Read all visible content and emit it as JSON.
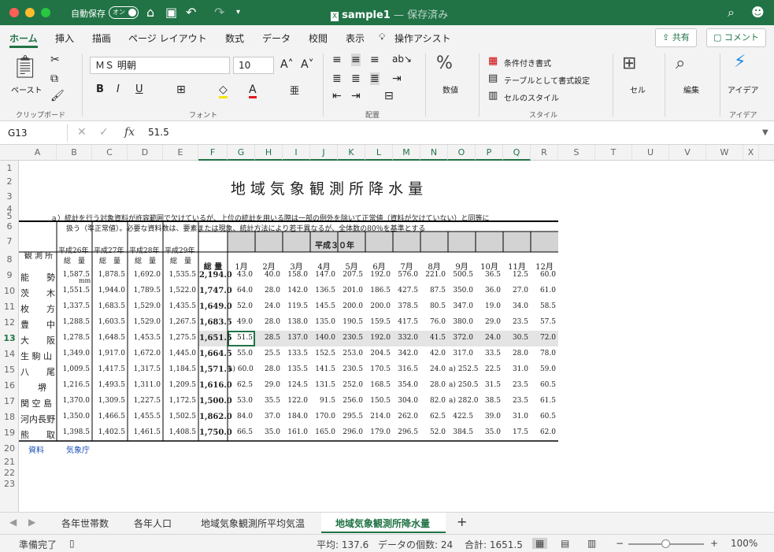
{
  "title_bar": {
    "autosave": "自動保存",
    "toggle": "オン",
    "filename": "sample1",
    "saved": " — 保存済み"
  },
  "ribbon_tabs": [
    "ホーム",
    "挿入",
    "描画",
    "ページ レイアウト",
    "数式",
    "データ",
    "校閲",
    "表示",
    "操作アシスト"
  ],
  "share": "共有",
  "comment": "コメント",
  "ribbon": {
    "paste": "ペースト",
    "clipboard": "クリップボード",
    "font_name": "ＭＳ 明朝",
    "font_size": "10",
    "font": "フォント",
    "align": "配置",
    "number": "数値",
    "cond": "条件付き書式",
    "table": "テーブルとして書式設定",
    "cellstyle": "セルのスタイル",
    "style": "スタイル",
    "cell": "セル",
    "edit": "編集",
    "ideas": "アイデア",
    "ideas_grp": "アイデア"
  },
  "formula_bar": {
    "namebox": "G13",
    "value": "51.5"
  },
  "columns": [
    "A",
    "B",
    "C",
    "D",
    "E",
    "F",
    "G",
    "H",
    "I",
    "J",
    "K",
    "L",
    "M",
    "N",
    "O",
    "P",
    "Q",
    "R",
    "S",
    "T",
    "U",
    "V",
    "W",
    "X"
  ],
  "rows": [
    "1",
    "2",
    "3",
    "4",
    "5",
    "6",
    "7",
    "8",
    "9",
    "10",
    "11",
    "12",
    "13",
    "14",
    "15",
    "16",
    "17",
    "18",
    "19",
    "20",
    "21",
    "22",
    "23"
  ],
  "sheet": {
    "title": "地 域 気 象 観 測 所 降 水 量",
    "note1": "ａ）統計を行う対象資料が許容範囲で欠けているが、上位の統計を用いる際は一部の例外を除いて正常値（資料が欠けていない）と同等に",
    "note2": "扱う（準正常値）。必要な資料数は、要素または現象、統計方法により若干異なるが、全体数の80％を基準とする",
    "header_station": "観 測 所",
    "years": [
      "平成26年",
      "平成27年",
      "平成28年",
      "平成29年"
    ],
    "year_sub": "総　量",
    "heisei30": "平成３０年",
    "total": "総 量",
    "months": [
      "1月",
      "2月",
      "3月",
      "4月",
      "5月",
      "6月",
      "7月",
      "8月",
      "9月",
      "10月",
      "11月",
      "12月"
    ],
    "unit": "mm",
    "source_label": "資料",
    "source": "気象庁",
    "data": [
      [
        "能　　勢",
        "1,587.5",
        "1,878.5",
        "1,692.0",
        "1,535.5",
        "2,194.0",
        "43.0",
        "40.0",
        "158.0",
        "147.0",
        "207.5",
        "192.0",
        "576.0",
        "221.0",
        "500.5",
        "36.5",
        "12.5",
        "60.0"
      ],
      [
        "茨　　木",
        "1,551.5",
        "1,944.0",
        "1,789.5",
        "1,522.0",
        "1,747.0",
        "64.0",
        "28.0",
        "142.0",
        "136.5",
        "201.0",
        "186.5",
        "427.5",
        "87.5",
        "350.0",
        "36.0",
        "27.0",
        "61.0"
      ],
      [
        "枚　　方",
        "1,337.5",
        "1,683.5",
        "1,529.0",
        "1,435.5",
        "1,649.0",
        "52.0",
        "24.0",
        "119.5",
        "145.5",
        "200.0",
        "200.0",
        "378.5",
        "80.5",
        "347.0",
        "19.0",
        "34.0",
        "58.5"
      ],
      [
        "豊　　中",
        "1,288.5",
        "1,603.5",
        "1,529.0",
        "1,267.5",
        "1,683.5",
        "49.0",
        "28.0",
        "138.0",
        "135.0",
        "190.5",
        "159.5",
        "417.5",
        "76.0",
        "380.0",
        "29.0",
        "23.5",
        "57.5"
      ],
      [
        "大　　阪",
        "1,278.5",
        "1,648.5",
        "1,453.5",
        "1,275.5",
        "1,651.5",
        "51.5",
        "28.5",
        "137.0",
        "140.0",
        "230.5",
        "192.0",
        "332.0",
        "41.5",
        "372.0",
        "24.0",
        "30.5",
        "72.0"
      ],
      [
        "生 駒 山",
        "1,349.0",
        "1,917.0",
        "1,672.0",
        "1,445.0",
        "1,664.5",
        "55.0",
        "25.5",
        "133.5",
        "152.5",
        "253.0",
        "204.5",
        "342.0",
        "42.0",
        "317.0",
        "33.5",
        "28.0",
        "78.0"
      ],
      [
        "八　　尾",
        "1,009.5",
        "1,417.5",
        "1,317.5",
        "1,184.5",
        "1,571.5",
        "a) 60.0",
        "28.0",
        "135.5",
        "141.5",
        "230.5",
        "170.5",
        "316.5",
        "24.0",
        "a) 252.5",
        "22.5",
        "31.0",
        "59.0"
      ],
      [
        "　　堺",
        "1,216.5",
        "1,493.5",
        "1,311.0",
        "1,209.5",
        "1,616.0",
        "62.5",
        "29.0",
        "124.5",
        "131.5",
        "252.0",
        "168.5",
        "354.0",
        "28.0",
        "a) 250.5",
        "31.5",
        "23.5",
        "60.5"
      ],
      [
        "関 空 島",
        "1,370.0",
        "1,309.5",
        "1,227.5",
        "1,172.5",
        "1,500.0",
        "53.0",
        "35.5",
        "122.0",
        "91.5",
        "256.0",
        "150.5",
        "304.0",
        "82.0",
        "a) 282.0",
        "38.5",
        "23.5",
        "61.5"
      ],
      [
        "河内長野",
        "1,350.0",
        "1,466.5",
        "1,455.5",
        "1,502.5",
        "1,862.0",
        "84.0",
        "37.0",
        "184.0",
        "170.0",
        "295.5",
        "214.0",
        "262.0",
        "62.5",
        "422.5",
        "39.0",
        "31.0",
        "60.5"
      ],
      [
        "熊　　取",
        "1,398.5",
        "1,402.5",
        "1,461.5",
        "1,408.5",
        "1,750.0",
        "66.5",
        "35.0",
        "161.0",
        "165.0",
        "296.0",
        "179.0",
        "296.5",
        "52.0",
        "384.5",
        "35.0",
        "17.5",
        "62.0"
      ]
    ]
  },
  "sheet_tabs": [
    "各年世帯数",
    "各年人口",
    "地域気象観測所平均気温",
    "地域気象観測所降水量"
  ],
  "status": {
    "ready": "準備完了",
    "avg": "平均: 137.6",
    "count": "データの個数: 24",
    "sum": "合計: 1651.5",
    "zoom": "100%"
  }
}
